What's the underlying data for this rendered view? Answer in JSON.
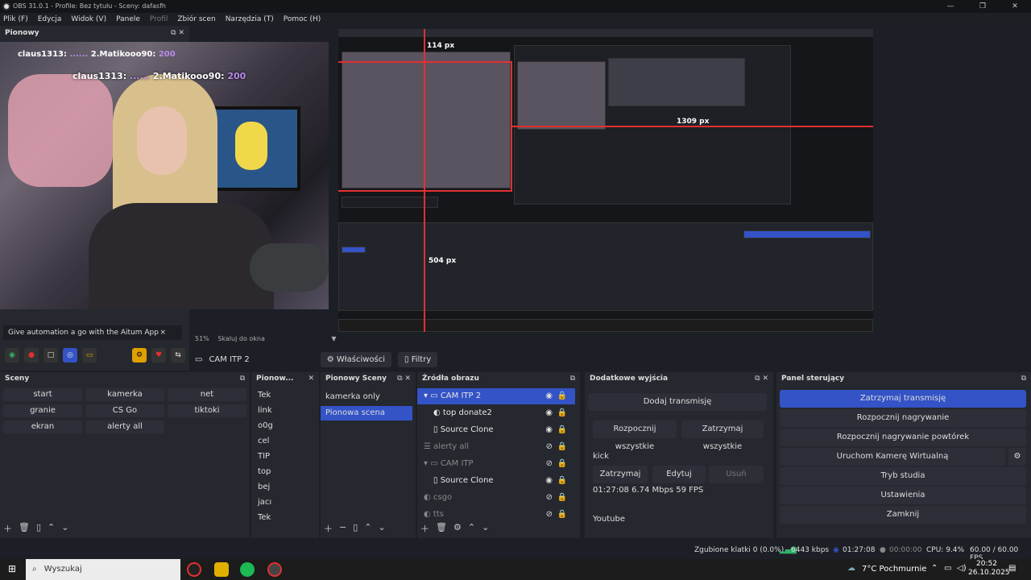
{
  "window": {
    "title": "OBS 31.0.1 - Profile: Bez tytułu - Sceny: dafasfh"
  },
  "menu": [
    "Plik (F)",
    "Edycja",
    "Widok (V)",
    "Panele",
    "Profil",
    "Zbiór scen",
    "Narzędzia (T)",
    "Pomoc (H)"
  ],
  "pionowy_dock": {
    "title": "Pionowy",
    "overlay_rank1": "claus1313:",
    "overlay_rank1_amount": "...",
    "overlay_rank2": "2.Matikooo90:",
    "overlay_rank2_amount": "200",
    "automation_banner": "Give automation a go with the Aitum App",
    "automation_close": "×"
  },
  "preview": {
    "labels": {
      "px_top": "114 px",
      "px_right": "1309 px",
      "px_mid": "504 px"
    },
    "status_zoom": "51%",
    "status_scale": "Skaluj do okna"
  },
  "source_toolbar": {
    "selected_source": "CAM ITP 2",
    "properties": "Właściwości",
    "filters": "Filtry"
  },
  "sceny": {
    "title": "Sceny",
    "buttons": [
      [
        "start",
        "kamerka",
        "net"
      ],
      [
        "granie",
        "CS Go",
        "tiktoki"
      ],
      [
        "ekran",
        "alerty all",
        ""
      ]
    ],
    "selected": "ekran"
  },
  "pionowe_zrodla": {
    "title": "Pionow...",
    "items": [
      "Tek",
      "link",
      "o0g",
      "cel",
      "TIP",
      "top",
      "bej",
      "jacı",
      "Tek"
    ]
  },
  "pionowy_sceny": {
    "title": "Pionowy Sceny",
    "items": [
      "kamerka only",
      "Pionowa scena"
    ],
    "selected": "Pionowa scena"
  },
  "zrodla": {
    "title": "Źródła obrazu",
    "items": [
      {
        "label": "CAM ITP 2",
        "indent": 0,
        "group": true,
        "selected": true
      },
      {
        "label": "top donate2",
        "indent": 1
      },
      {
        "label": "Source Clone",
        "indent": 1
      },
      {
        "label": "alerty all",
        "indent": 0,
        "dim": true
      },
      {
        "label": "CAM ITP",
        "indent": 0,
        "group": true,
        "dim": true
      },
      {
        "label": "Source Clone",
        "indent": 1
      },
      {
        "label": "csgo",
        "indent": 0,
        "dim": true
      },
      {
        "label": "tts",
        "indent": 0,
        "dim": true
      }
    ]
  },
  "dodatkowe": {
    "title": "Dodatkowe wyjścia",
    "add_stream": "Dodaj transmisję",
    "start_all": "Rozpocznij wszystkie",
    "stop_all": "Zatrzymaj wszystkie",
    "kick_label": "kick",
    "stop": "Zatrzymaj",
    "edit": "Edytuj",
    "remove": "Usuń",
    "kick_stats": "01:27:08 6.74 Mbps  59 FPS",
    "youtube_label": "Youtube"
  },
  "sterujacy": {
    "title": "Panel sterujący",
    "buttons": [
      "Zatrzymaj transmisję",
      "Rozpocznij nagrywanie",
      "Rozpocznij nagrywanie powtórek",
      "Uruchom Kamerę Wirtualną",
      "Tryb studia",
      "Ustawienia",
      "Zamknij"
    ]
  },
  "statusbar": {
    "dropped": "Zgubione klatki 0 (0.0%)",
    "kbps": "6443 kbps",
    "stream_time": "01:27:08",
    "rec_time": "00:00:00",
    "cpu": "CPU: 9.4%",
    "fps": "60.00 / 60.00 FPS"
  },
  "taskbar": {
    "search": "Wyszukaj",
    "weather": "7°C  Pochmurnie",
    "time": "20:52",
    "date": "26.10.2025"
  },
  "colors": {
    "accent": "#3353c6",
    "record_red": "#e23030"
  }
}
